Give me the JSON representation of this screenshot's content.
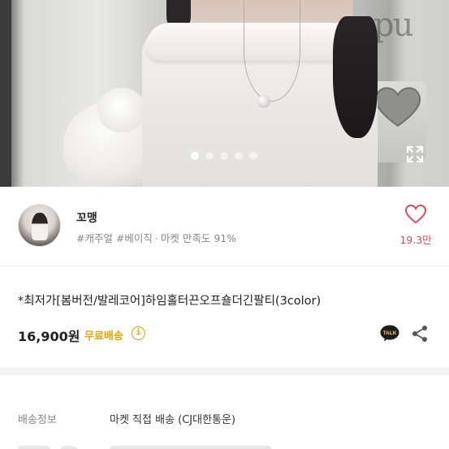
{
  "photo": {
    "page_dots": 5,
    "active_index": 0,
    "expand_icon": "expand-icon"
  },
  "seller": {
    "name": "꼬맹",
    "tags": "#캐주얼 #베이직",
    "satisfaction": "마켓 만족도 91%",
    "like_icon": "heart-outline-icon",
    "like_count": "19.3만",
    "like_color": "#e5475b"
  },
  "product": {
    "title": "*최저가[봄버전/발레코어]하임홀터끈오프숄더긴팔티(3color)",
    "price": "16,900원",
    "shipping_badge": "무료배송",
    "shipping_color": "#e9a100",
    "info_icon": "info-icon",
    "talk_icon": "kakao-talk-icon",
    "talk_label": "TALK",
    "share_icon": "share-icon"
  },
  "delivery": {
    "label": "배송정보",
    "value": "마켓 직접 배송 (CJ대한통운)"
  }
}
